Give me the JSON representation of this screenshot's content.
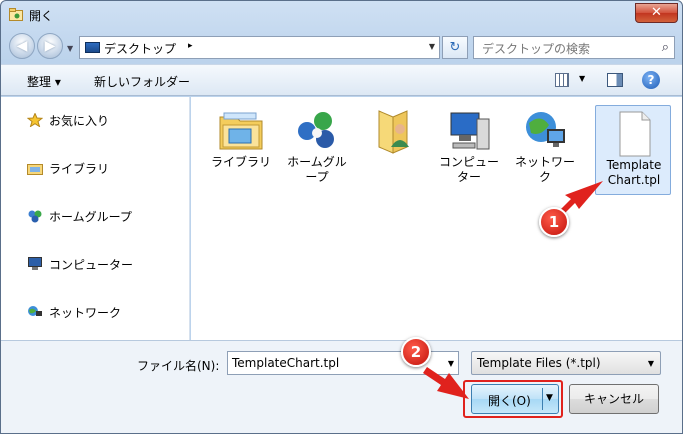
{
  "window": {
    "title": "開く",
    "close_label": "✕"
  },
  "nav": {
    "back_icon": "◀",
    "forward_icon": "▶"
  },
  "address": {
    "location": "デスクトップ",
    "arrow": "▸",
    "refresh_icon": "↻"
  },
  "search": {
    "placeholder": "デスクトップの検索",
    "icon": "⌕"
  },
  "toolbar": {
    "organize": "整理 ▾",
    "new_folder": "新しいフォルダー",
    "help": "?"
  },
  "sidebar": {
    "items": [
      {
        "label": "お気に入り",
        "icon": "star-icon"
      },
      {
        "label": "ライブラリ",
        "icon": "library-icon"
      },
      {
        "label": "ホームグループ",
        "icon": "homegroup-icon"
      },
      {
        "label": "コンピューター",
        "icon": "computer-icon"
      },
      {
        "label": "ネットワーク",
        "icon": "network-icon"
      }
    ]
  },
  "files": [
    {
      "label": "ライブラリ",
      "icon": "library-icon"
    },
    {
      "label": "ホームグル\nープ",
      "icon": "homegroup-icon"
    },
    {
      "label": "",
      "icon": "user-folder-icon"
    },
    {
      "label": "コンピュー\nター",
      "icon": "computer-icon"
    },
    {
      "label": "ネットワー\nク",
      "icon": "network-icon"
    },
    {
      "label": "Template\nChart.tpl",
      "icon": "file-icon",
      "selected": true
    }
  ],
  "filename": {
    "label": "ファイル名(N):",
    "value": "TemplateChart.tpl"
  },
  "filetype": {
    "value": "Template Files (*.tpl)"
  },
  "buttons": {
    "open": "開く(O)",
    "cancel": "キャンセル"
  },
  "annotations": {
    "step1": "1",
    "step2": "2"
  },
  "colors": {
    "highlight": "#e0221d",
    "accent": "#3c7fb1"
  }
}
